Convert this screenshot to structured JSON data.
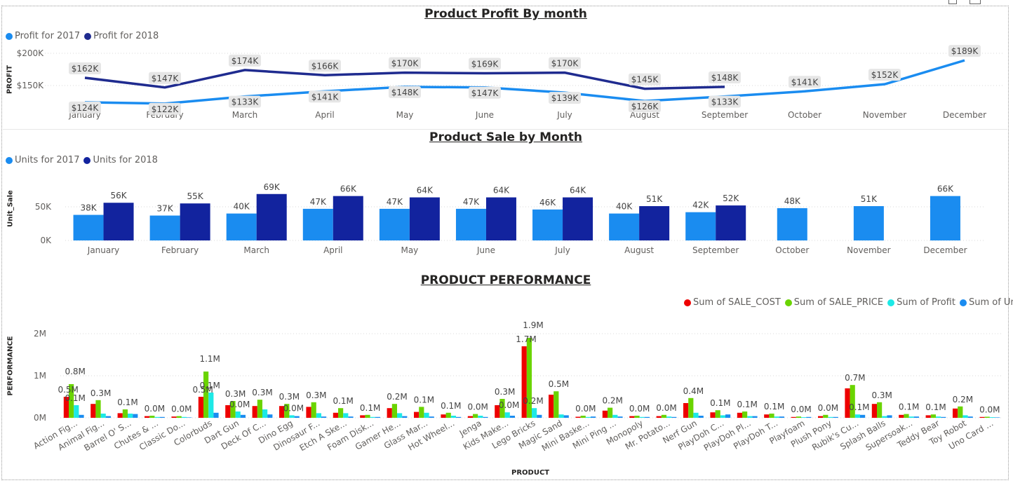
{
  "colors": {
    "light_blue": "#1a8cf0",
    "dark_blue": "#1f2b8f",
    "dark_blue_bar": "#12239e",
    "red": "#ee0000",
    "green": "#6ad400",
    "cyan": "#1de9e6",
    "blue": "#1a8cf0",
    "label_bg": "#e6e6e6",
    "grid": "#d8d8d8"
  },
  "chart_data": [
    {
      "type": "line",
      "title": "Product Profit By month",
      "ylabel": "PROFIT",
      "categories": [
        "January",
        "February",
        "March",
        "April",
        "May",
        "June",
        "July",
        "August",
        "September",
        "October",
        "November",
        "December"
      ],
      "y_ticks": [
        {
          "value": 150000,
          "label": "$150K"
        },
        {
          "value": 200000,
          "label": "$200K"
        }
      ],
      "series": [
        {
          "name": "Profit for 2017",
          "values": [
            124000,
            122000,
            133000,
            141000,
            148000,
            147000,
            139000,
            126000,
            133000,
            141000,
            152000,
            189000
          ],
          "labels": [
            "$124K",
            "$122K",
            "$133K",
            "$141K",
            "$148K",
            "$147K",
            "$139K",
            "$126K",
            "$133K",
            "$141K",
            "$152K",
            "$189K"
          ]
        },
        {
          "name": "Profit for 2018",
          "values": [
            162000,
            147000,
            174000,
            166000,
            170000,
            169000,
            170000,
            145000,
            148000,
            null,
            null,
            null
          ],
          "labels": [
            "$162K",
            "$147K",
            "$174K",
            "$166K",
            "$170K",
            "$169K",
            "$170K",
            "$145K",
            "$148K",
            null,
            null,
            null
          ]
        }
      ]
    },
    {
      "type": "bar",
      "title": "Product Sale by Month",
      "ylabel": "Unit_Sale",
      "categories": [
        "January",
        "February",
        "March",
        "April",
        "May",
        "June",
        "July",
        "August",
        "September",
        "October",
        "November",
        "December"
      ],
      "y_ticks": [
        {
          "value": 0,
          "label": "0K"
        },
        {
          "value": 50000,
          "label": "50K"
        }
      ],
      "series": [
        {
          "name": "Units for 2017",
          "values": [
            38000,
            37000,
            40000,
            47000,
            47000,
            47000,
            46000,
            40000,
            42000,
            48000,
            51000,
            66000
          ],
          "labels": [
            "38K",
            "37K",
            "40K",
            "47K",
            "47K",
            "47K",
            "46K",
            "40K",
            "42K",
            "48K",
            "51K",
            "66K"
          ]
        },
        {
          "name": "Units for 2018",
          "values": [
            56000,
            55000,
            69000,
            66000,
            64000,
            64000,
            64000,
            51000,
            52000,
            null,
            null,
            null
          ],
          "labels": [
            "56K",
            "55K",
            "69K",
            "66K",
            "64K",
            "64K",
            "64K",
            "51K",
            "52K",
            null,
            null,
            null
          ]
        }
      ]
    },
    {
      "type": "bar",
      "title": "PRODUCT PERFORMANCE",
      "ylabel": "PERFORMANCE",
      "xlabel": "PRODUCT",
      "categories": [
        "Action Fig...",
        "Animal Fig...",
        "Barrel O' S...",
        "Chutes & ...",
        "Classic Do...",
        "Colorbuds",
        "Dart Gun",
        "Deck Of C...",
        "Dino Egg",
        "Dinosaur F...",
        "Etch A Ske...",
        "Foam Disk...",
        "Gamer He...",
        "Glass Mar...",
        "Hot Wheel...",
        "Jenga",
        "Kids Make...",
        "Lego Bricks",
        "Magic Sand",
        "Mini Baske...",
        "Mini Ping ...",
        "Monopoly",
        "Mr. Potato...",
        "Nerf Gun",
        "PlayDoh C...",
        "PlayDoh Pl...",
        "PlayDoh T...",
        "Playfoam",
        "Plush Pony",
        "Rubik's Cu...",
        "Splash Balls",
        "Supersoak...",
        "Teddy Bear",
        "Toy Robot",
        "Uno Card ..."
      ],
      "y_ticks": [
        {
          "value": 0,
          "label": "0M"
        },
        {
          "value": 1000000,
          "label": "1M"
        },
        {
          "value": 2000000,
          "label": "2M"
        }
      ],
      "series": [
        {
          "name": "Sum of SALE_COST",
          "values": [
            500000,
            330000,
            110000,
            40000,
            30000,
            500000,
            300000,
            280000,
            280000,
            260000,
            120000,
            60000,
            230000,
            140000,
            80000,
            40000,
            300000,
            1700000,
            550000,
            25000,
            170000,
            40000,
            40000,
            350000,
            130000,
            120000,
            80000,
            20000,
            40000,
            700000,
            330000,
            70000,
            60000,
            220000,
            20000
          ]
        },
        {
          "name": "Sum of SALE_PRICE",
          "values": [
            800000,
            420000,
            200000,
            50000,
            40000,
            1100000,
            400000,
            430000,
            330000,
            370000,
            230000,
            70000,
            330000,
            260000,
            120000,
            90000,
            450000,
            1900000,
            630000,
            50000,
            240000,
            50000,
            70000,
            470000,
            180000,
            150000,
            100000,
            30000,
            70000,
            780000,
            370000,
            90000,
            80000,
            270000,
            25000
          ]
        },
        {
          "name": "Sum of Profit",
          "values": [
            300000,
            100000,
            100000,
            20000,
            20000,
            600000,
            150000,
            200000,
            60000,
            110000,
            110000,
            20000,
            110000,
            120000,
            50000,
            50000,
            130000,
            230000,
            80000,
            20000,
            70000,
            20000,
            30000,
            120000,
            60000,
            40000,
            30000,
            15000,
            20000,
            80000,
            40000,
            30000,
            30000,
            60000,
            15000
          ]
        },
        {
          "name": "Sum of Units",
          "values": [
            70000,
            40000,
            90000,
            20000,
            10000,
            120000,
            70000,
            80000,
            40000,
            30000,
            30000,
            20000,
            40000,
            30000,
            20000,
            20000,
            50000,
            70000,
            60000,
            30000,
            30000,
            20000,
            20000,
            50000,
            80000,
            40000,
            30000,
            20000,
            20000,
            70000,
            60000,
            30000,
            20000,
            30000,
            10000
          ]
        }
      ],
      "data_labels": [
        {
          "index": 0,
          "texts": [
            "0.5M",
            "0.8M",
            "0.1M"
          ]
        },
        {
          "index": 1,
          "texts": [
            "0.3M"
          ]
        },
        {
          "index": 2,
          "texts": [
            "0.1M"
          ]
        },
        {
          "index": 3,
          "texts": [
            "0.0M"
          ]
        },
        {
          "index": 4,
          "texts": [
            "0.0M"
          ]
        },
        {
          "index": 5,
          "texts": [
            "0.5M",
            "1.1M",
            "0.1M"
          ]
        },
        {
          "index": 6,
          "texts": [
            "0.3M",
            "0.0M"
          ]
        },
        {
          "index": 7,
          "texts": [
            "0.3M"
          ]
        },
        {
          "index": 8,
          "texts": [
            "0.3M",
            "0.0M"
          ]
        },
        {
          "index": 9,
          "texts": [
            "0.3M"
          ]
        },
        {
          "index": 10,
          "texts": [
            "0.1M"
          ]
        },
        {
          "index": 11,
          "texts": [
            "0.1M"
          ]
        },
        {
          "index": 12,
          "texts": [
            "0.2M"
          ]
        },
        {
          "index": 13,
          "texts": [
            "0.1M"
          ]
        },
        {
          "index": 14,
          "texts": [
            "0.1M"
          ]
        },
        {
          "index": 15,
          "texts": [
            "0.0M"
          ]
        },
        {
          "index": 16,
          "texts": [
            "0.3M",
            "0.0M"
          ]
        },
        {
          "index": 17,
          "texts": [
            "1.7M",
            "1.9M",
            "0.2M"
          ]
        },
        {
          "index": 18,
          "texts": [
            "0.5M"
          ]
        },
        {
          "index": 19,
          "texts": [
            "0.0M"
          ]
        },
        {
          "index": 20,
          "texts": [
            "0.2M"
          ]
        },
        {
          "index": 21,
          "texts": [
            "0.0M"
          ]
        },
        {
          "index": 22,
          "texts": [
            "0.0M"
          ]
        },
        {
          "index": 23,
          "texts": [
            "0.4M"
          ]
        },
        {
          "index": 24,
          "texts": [
            "0.1M"
          ]
        },
        {
          "index": 25,
          "texts": [
            "0.1M"
          ]
        },
        {
          "index": 26,
          "texts": [
            "0.1M"
          ]
        },
        {
          "index": 27,
          "texts": [
            "0.0M"
          ]
        },
        {
          "index": 28,
          "texts": [
            "0.0M"
          ]
        },
        {
          "index": 29,
          "texts": [
            "0.7M",
            "0.1M"
          ]
        },
        {
          "index": 30,
          "texts": [
            "0.3M"
          ]
        },
        {
          "index": 31,
          "texts": [
            "0.1M"
          ]
        },
        {
          "index": 32,
          "texts": [
            "0.1M"
          ]
        },
        {
          "index": 33,
          "texts": [
            "0.2M"
          ]
        },
        {
          "index": 34,
          "texts": [
            "0.0M"
          ]
        }
      ]
    }
  ]
}
